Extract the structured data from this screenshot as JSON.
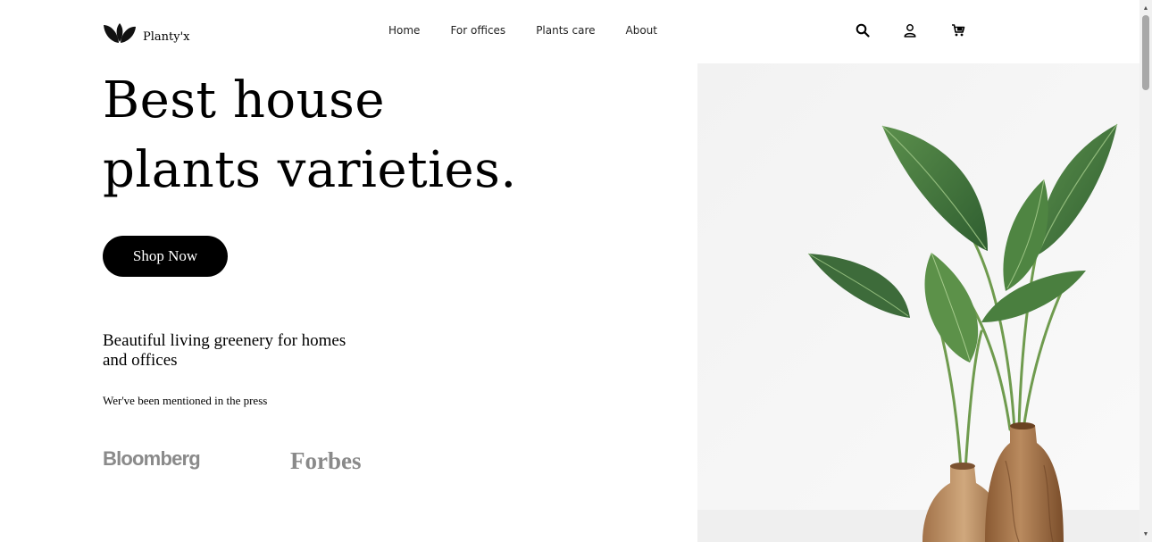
{
  "brand": {
    "name": "Planty'x",
    "logo_icon": "leaf-logo-icon"
  },
  "nav": {
    "items": [
      "Home",
      "For offices",
      "Plants care",
      "About"
    ]
  },
  "header_icons": [
    "search-icon",
    "user-icon",
    "cart-icon"
  ],
  "hero": {
    "title_line1": "Best house",
    "title_line2": "plants varieties.",
    "cta_label": "Shop Now",
    "subtitle": "Beautiful living greenery for homes and offices",
    "press_label": "Wer've been mentioned in the press",
    "press_logos": [
      "Bloomberg",
      "Forbes"
    ]
  },
  "colors": {
    "text": "#000000",
    "button_bg": "#000000",
    "button_text": "#ffffff",
    "press_logo": "#8a8a8a",
    "leaf": "#3f7a3a"
  }
}
